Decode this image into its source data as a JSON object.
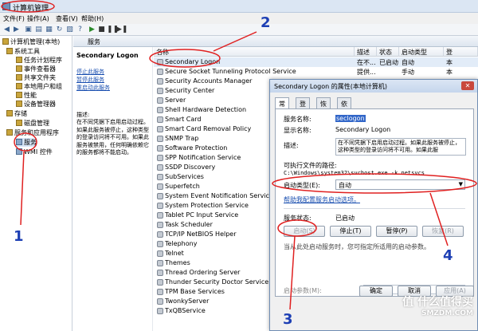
{
  "window": {
    "title": "计算机管理"
  },
  "menu": {
    "items": [
      "文件(F)",
      "操作(A)",
      "查看(V)",
      "帮助(H)"
    ]
  },
  "tree": {
    "items": [
      {
        "label": "计算机管理(本地)"
      },
      {
        "label": "系统工具"
      },
      {
        "label": "任务计划程序"
      },
      {
        "label": "事件查看器"
      },
      {
        "label": "共享文件夹"
      },
      {
        "label": "本地用户和组"
      },
      {
        "label": "性能"
      },
      {
        "label": "设备管理器"
      },
      {
        "label": "存储"
      },
      {
        "label": "磁盘管理"
      },
      {
        "label": "服务和应用程序"
      },
      {
        "label": "服务"
      },
      {
        "label": "WMI 控件"
      }
    ]
  },
  "pane_header": {
    "title": "服务"
  },
  "description": {
    "service_name": "Secondary Logon",
    "stop_link": "停止此服务",
    "pause_link": "暂停此服务",
    "restart_link": "重启动此服务",
    "desc_label": "描述:",
    "desc_text": "在不同凭据下启用启动过程。如果此服务被停止，这种类型的登录访问将不可用。如果此服务被禁用，任何明确依赖它的服务都将不能启动。"
  },
  "list": {
    "columns": [
      "名称",
      "描述",
      "状态",
      "启动类型",
      "登"
    ],
    "rows": [
      {
        "name": "Secondary Logon",
        "desc": "在不...",
        "status": "已启动",
        "startup": "自动",
        "logon": "本"
      },
      {
        "name": "Secure Socket Tunneling Protocol Service",
        "desc": "提供...",
        "status": "",
        "startup": "手动",
        "logon": "本"
      },
      {
        "name": "Security Accounts Manager",
        "desc": "",
        "status": "",
        "startup": "",
        "logon": ""
      },
      {
        "name": "Security Center",
        "desc": "",
        "status": "",
        "startup": "",
        "logon": ""
      },
      {
        "name": "Server",
        "desc": "",
        "status": "",
        "startup": "",
        "logon": ""
      },
      {
        "name": "Shell Hardware Detection",
        "desc": "",
        "status": "",
        "startup": "",
        "logon": ""
      },
      {
        "name": "Smart Card",
        "desc": "",
        "status": "",
        "startup": "",
        "logon": ""
      },
      {
        "name": "Smart Card Removal Policy",
        "desc": "",
        "status": "",
        "startup": "",
        "logon": ""
      },
      {
        "name": "SNMP Trap",
        "desc": "",
        "status": "",
        "startup": "",
        "logon": ""
      },
      {
        "name": "Software Protection",
        "desc": "",
        "status": "",
        "startup": "",
        "logon": ""
      },
      {
        "name": "SPP Notification Service",
        "desc": "",
        "status": "",
        "startup": "",
        "logon": ""
      },
      {
        "name": "SSDP Discovery",
        "desc": "",
        "status": "",
        "startup": "",
        "logon": ""
      },
      {
        "name": "SubServices",
        "desc": "",
        "status": "",
        "startup": "",
        "logon": ""
      },
      {
        "name": "Superfetch",
        "desc": "",
        "status": "",
        "startup": "",
        "logon": ""
      },
      {
        "name": "System Event Notification Service",
        "desc": "",
        "status": "",
        "startup": "",
        "logon": ""
      },
      {
        "name": "System Protection Service",
        "desc": "",
        "status": "",
        "startup": "",
        "logon": ""
      },
      {
        "name": "Tablet PC Input Service",
        "desc": "",
        "status": "",
        "startup": "",
        "logon": ""
      },
      {
        "name": "Task Scheduler",
        "desc": "",
        "status": "",
        "startup": "",
        "logon": ""
      },
      {
        "name": "TCP/IP NetBIOS Helper",
        "desc": "",
        "status": "",
        "startup": "",
        "logon": ""
      },
      {
        "name": "Telephony",
        "desc": "",
        "status": "",
        "startup": "",
        "logon": ""
      },
      {
        "name": "Telnet",
        "desc": "",
        "status": "",
        "startup": "",
        "logon": ""
      },
      {
        "name": "Themes",
        "desc": "",
        "status": "",
        "startup": "",
        "logon": ""
      },
      {
        "name": "Thread Ordering Server",
        "desc": "",
        "status": "",
        "startup": "",
        "logon": ""
      },
      {
        "name": "Thunder Security Doctor Service",
        "desc": "",
        "status": "",
        "startup": "",
        "logon": ""
      },
      {
        "name": "TPM Base Services",
        "desc": "",
        "status": "",
        "startup": "",
        "logon": ""
      },
      {
        "name": "TwonkyServer",
        "desc": "",
        "status": "",
        "startup": "",
        "logon": ""
      },
      {
        "name": "TxQBService",
        "desc": "",
        "status": "",
        "startup": "",
        "logon": ""
      }
    ]
  },
  "dialog": {
    "title": "Secondary Logon 的属性(本地计算机)",
    "close": "✕",
    "tabs": [
      "常规",
      "登录",
      "恢复",
      "依存关系"
    ],
    "service_name_label": "服务名称:",
    "service_name_value": "seclogon",
    "display_name_label": "显示名称:",
    "display_name_value": "Secondary Logon",
    "desc_label": "描述:",
    "desc_value": "在不同凭据下启用启动过程。如果此服务被停止，这种类型的登录访问将不可用。如果此服",
    "path_label": "可执行文件的路径:",
    "path_value": "C:\\Windows\\system32\\svchost.exe -k netsvcs",
    "startup_label": "启动类型(E):",
    "startup_value": "自动",
    "help_link": "帮助我配置服务启动选项。",
    "status_label": "服务状态:",
    "status_value": "已启动",
    "btn_start": "启动(S)",
    "btn_stop": "停止(T)",
    "btn_pause": "暂停(P)",
    "btn_resume": "恢复(R)",
    "hint": "当从此处启动服务时，您可指定所适用的启动参数。",
    "params_label": "启动参数(M):",
    "btn_ok": "确定",
    "btn_cancel": "取消",
    "btn_apply": "应用(A)"
  },
  "annotations": {
    "n1": "1",
    "n2": "2",
    "n3": "3",
    "n4": "4"
  },
  "watermark": {
    "main": "值 什么值得买",
    "sub": "SMZDM.COM"
  },
  "colors": {
    "annotation_red": "#e02020",
    "annotation_number": "#1d3fb4"
  }
}
